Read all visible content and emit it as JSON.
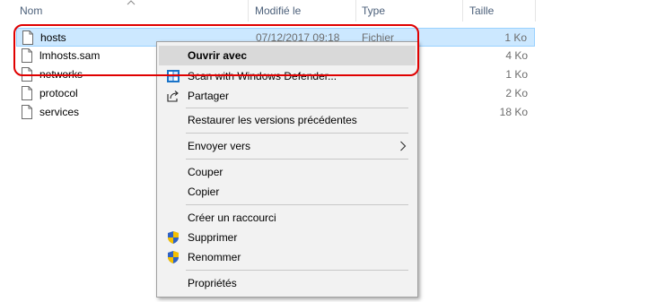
{
  "columns": {
    "name": "Nom",
    "modified": "Modifié le",
    "type": "Type",
    "size": "Taille"
  },
  "files": [
    {
      "name": "hosts",
      "modified": "07/12/2017 09:18",
      "type": "Fichier",
      "size": "1 Ko",
      "selected": true
    },
    {
      "name": "lmhosts.sam",
      "modified": "",
      "type": "",
      "size": "4 Ko",
      "selected": false
    },
    {
      "name": "networks",
      "modified": "",
      "type": "",
      "size": "1 Ko",
      "selected": false
    },
    {
      "name": "protocol",
      "modified": "",
      "type": "",
      "size": "2 Ko",
      "selected": false
    },
    {
      "name": "services",
      "modified": "",
      "type": "",
      "size": "18 Ko",
      "selected": false
    }
  ],
  "context_menu": {
    "open_with": "Ouvrir avec",
    "scan_defender": "Scan with Windows Defender...",
    "share": "Partager",
    "restore_versions": "Restaurer les versions précédentes",
    "send_to": "Envoyer vers",
    "cut": "Couper",
    "copy": "Copier",
    "create_shortcut": "Créer un raccourci",
    "delete": "Supprimer",
    "rename": "Renommer",
    "properties": "Propriétés"
  },
  "icons": {
    "file": "file-icon",
    "defender": "windows-defender-icon",
    "share": "share-icon",
    "shield": "uac-shield-icon",
    "submenu": "chevron-right-icon",
    "sort": "sort-ascending-icon"
  },
  "colors": {
    "selection_bg": "#cce8ff",
    "selection_border": "#99d1ff",
    "highlight": "#e00000",
    "menu_bg": "#f2f2f2",
    "menu_hover": "#d9d9d9"
  }
}
